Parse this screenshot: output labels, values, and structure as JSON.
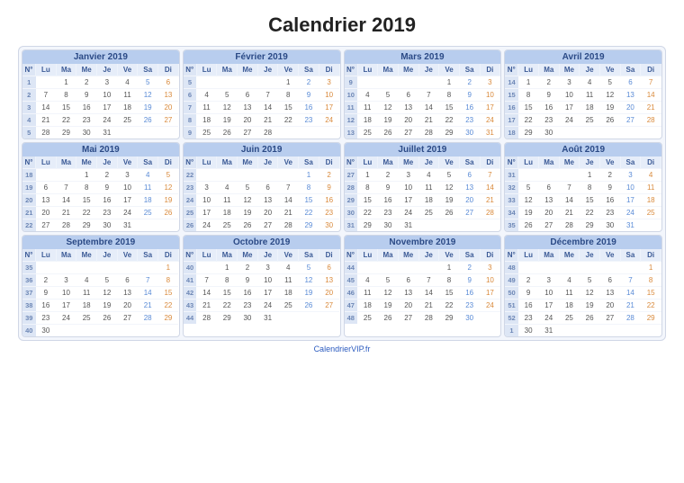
{
  "title": "Calendrier 2019",
  "footer": "CalendrierVIP.fr",
  "dayHeaders": [
    "N°",
    "Lu",
    "Ma",
    "Me",
    "Je",
    "Ve",
    "Sa",
    "Di"
  ],
  "months": [
    {
      "name": "Janvier 2019",
      "weeks": [
        {
          "wk": 1,
          "d": [
            "",
            "1",
            "2",
            "3",
            "4",
            "5",
            "6"
          ]
        },
        {
          "wk": 2,
          "d": [
            "7",
            "8",
            "9",
            "10",
            "11",
            "12",
            "13"
          ]
        },
        {
          "wk": 3,
          "d": [
            "14",
            "15",
            "16",
            "17",
            "18",
            "19",
            "20"
          ]
        },
        {
          "wk": 4,
          "d": [
            "21",
            "22",
            "23",
            "24",
            "25",
            "26",
            "27"
          ]
        },
        {
          "wk": 5,
          "d": [
            "28",
            "29",
            "30",
            "31",
            "",
            "",
            ""
          ]
        }
      ]
    },
    {
      "name": "Février 2019",
      "weeks": [
        {
          "wk": 5,
          "d": [
            "",
            "",
            "",
            "",
            "1",
            "2",
            "3"
          ]
        },
        {
          "wk": 6,
          "d": [
            "4",
            "5",
            "6",
            "7",
            "8",
            "9",
            "10"
          ]
        },
        {
          "wk": 7,
          "d": [
            "11",
            "12",
            "13",
            "14",
            "15",
            "16",
            "17"
          ]
        },
        {
          "wk": 8,
          "d": [
            "18",
            "19",
            "20",
            "21",
            "22",
            "23",
            "24"
          ]
        },
        {
          "wk": 9,
          "d": [
            "25",
            "26",
            "27",
            "28",
            "",
            "",
            ""
          ]
        }
      ]
    },
    {
      "name": "Mars 2019",
      "weeks": [
        {
          "wk": 9,
          "d": [
            "",
            "",
            "",
            "",
            "1",
            "2",
            "3"
          ]
        },
        {
          "wk": 10,
          "d": [
            "4",
            "5",
            "6",
            "7",
            "8",
            "9",
            "10"
          ]
        },
        {
          "wk": 11,
          "d": [
            "11",
            "12",
            "13",
            "14",
            "15",
            "16",
            "17"
          ]
        },
        {
          "wk": 12,
          "d": [
            "18",
            "19",
            "20",
            "21",
            "22",
            "23",
            "24"
          ]
        },
        {
          "wk": 13,
          "d": [
            "25",
            "26",
            "27",
            "28",
            "29",
            "30",
            "31"
          ]
        }
      ]
    },
    {
      "name": "Avril 2019",
      "weeks": [
        {
          "wk": 14,
          "d": [
            "1",
            "2",
            "3",
            "4",
            "5",
            "6",
            "7"
          ]
        },
        {
          "wk": 15,
          "d": [
            "8",
            "9",
            "10",
            "11",
            "12",
            "13",
            "14"
          ]
        },
        {
          "wk": 16,
          "d": [
            "15",
            "16",
            "17",
            "18",
            "19",
            "20",
            "21"
          ]
        },
        {
          "wk": 17,
          "d": [
            "22",
            "23",
            "24",
            "25",
            "26",
            "27",
            "28"
          ]
        },
        {
          "wk": 18,
          "d": [
            "29",
            "30",
            "",
            "",
            "",
            "",
            ""
          ]
        }
      ]
    },
    {
      "name": "Mai 2019",
      "weeks": [
        {
          "wk": 18,
          "d": [
            "",
            "",
            "1",
            "2",
            "3",
            "4",
            "5"
          ]
        },
        {
          "wk": 19,
          "d": [
            "6",
            "7",
            "8",
            "9",
            "10",
            "11",
            "12"
          ]
        },
        {
          "wk": 20,
          "d": [
            "13",
            "14",
            "15",
            "16",
            "17",
            "18",
            "19"
          ]
        },
        {
          "wk": 21,
          "d": [
            "20",
            "21",
            "22",
            "23",
            "24",
            "25",
            "26"
          ]
        },
        {
          "wk": 22,
          "d": [
            "27",
            "28",
            "29",
            "30",
            "31",
            "",
            ""
          ]
        }
      ]
    },
    {
      "name": "Juin 2019",
      "weeks": [
        {
          "wk": 22,
          "d": [
            "",
            "",
            "",
            "",
            "",
            "1",
            "2"
          ]
        },
        {
          "wk": 23,
          "d": [
            "3",
            "4",
            "5",
            "6",
            "7",
            "8",
            "9"
          ]
        },
        {
          "wk": 24,
          "d": [
            "10",
            "11",
            "12",
            "13",
            "14",
            "15",
            "16"
          ]
        },
        {
          "wk": 25,
          "d": [
            "17",
            "18",
            "19",
            "20",
            "21",
            "22",
            "23"
          ]
        },
        {
          "wk": 26,
          "d": [
            "24",
            "25",
            "26",
            "27",
            "28",
            "29",
            "30"
          ]
        }
      ]
    },
    {
      "name": "Juillet 2019",
      "weeks": [
        {
          "wk": 27,
          "d": [
            "1",
            "2",
            "3",
            "4",
            "5",
            "6",
            "7"
          ]
        },
        {
          "wk": 28,
          "d": [
            "8",
            "9",
            "10",
            "11",
            "12",
            "13",
            "14"
          ]
        },
        {
          "wk": 29,
          "d": [
            "15",
            "16",
            "17",
            "18",
            "19",
            "20",
            "21"
          ]
        },
        {
          "wk": 30,
          "d": [
            "22",
            "23",
            "24",
            "25",
            "26",
            "27",
            "28"
          ]
        },
        {
          "wk": 31,
          "d": [
            "29",
            "30",
            "31",
            "",
            "",
            "",
            ""
          ]
        }
      ]
    },
    {
      "name": "Août 2019",
      "weeks": [
        {
          "wk": 31,
          "d": [
            "",
            "",
            "",
            "1",
            "2",
            "3",
            "4"
          ]
        },
        {
          "wk": 32,
          "d": [
            "5",
            "6",
            "7",
            "8",
            "9",
            "10",
            "11"
          ]
        },
        {
          "wk": 33,
          "d": [
            "12",
            "13",
            "14",
            "15",
            "16",
            "17",
            "18"
          ]
        },
        {
          "wk": 34,
          "d": [
            "19",
            "20",
            "21",
            "22",
            "23",
            "24",
            "25"
          ]
        },
        {
          "wk": 35,
          "d": [
            "26",
            "27",
            "28",
            "29",
            "30",
            "31",
            ""
          ]
        }
      ]
    },
    {
      "name": "Septembre 2019",
      "weeks": [
        {
          "wk": 35,
          "d": [
            "",
            "",
            "",
            "",
            "",
            "",
            "1"
          ]
        },
        {
          "wk": 36,
          "d": [
            "2",
            "3",
            "4",
            "5",
            "6",
            "7",
            "8"
          ]
        },
        {
          "wk": 37,
          "d": [
            "9",
            "10",
            "11",
            "12",
            "13",
            "14",
            "15"
          ]
        },
        {
          "wk": 38,
          "d": [
            "16",
            "17",
            "18",
            "19",
            "20",
            "21",
            "22"
          ]
        },
        {
          "wk": 39,
          "d": [
            "23",
            "24",
            "25",
            "26",
            "27",
            "28",
            "29"
          ]
        },
        {
          "wk": 40,
          "d": [
            "30",
            "",
            "",
            "",
            "",
            "",
            ""
          ]
        }
      ]
    },
    {
      "name": "Octobre 2019",
      "weeks": [
        {
          "wk": 40,
          "d": [
            "",
            "1",
            "2",
            "3",
            "4",
            "5",
            "6"
          ]
        },
        {
          "wk": 41,
          "d": [
            "7",
            "8",
            "9",
            "10",
            "11",
            "12",
            "13"
          ]
        },
        {
          "wk": 42,
          "d": [
            "14",
            "15",
            "16",
            "17",
            "18",
            "19",
            "20"
          ]
        },
        {
          "wk": 43,
          "d": [
            "21",
            "22",
            "23",
            "24",
            "25",
            "26",
            "27"
          ]
        },
        {
          "wk": 44,
          "d": [
            "28",
            "29",
            "30",
            "31",
            "",
            "",
            ""
          ]
        }
      ]
    },
    {
      "name": "Novembre 2019",
      "weeks": [
        {
          "wk": 44,
          "d": [
            "",
            "",
            "",
            "",
            "1",
            "2",
            "3"
          ]
        },
        {
          "wk": 45,
          "d": [
            "4",
            "5",
            "6",
            "7",
            "8",
            "9",
            "10"
          ]
        },
        {
          "wk": 46,
          "d": [
            "11",
            "12",
            "13",
            "14",
            "15",
            "16",
            "17"
          ]
        },
        {
          "wk": 47,
          "d": [
            "18",
            "19",
            "20",
            "21",
            "22",
            "23",
            "24"
          ]
        },
        {
          "wk": 48,
          "d": [
            "25",
            "26",
            "27",
            "28",
            "29",
            "30",
            ""
          ]
        }
      ]
    },
    {
      "name": "Décembre 2019",
      "weeks": [
        {
          "wk": 48,
          "d": [
            "",
            "",
            "",
            "",
            "",
            "",
            "1"
          ]
        },
        {
          "wk": 49,
          "d": [
            "2",
            "3",
            "4",
            "5",
            "6",
            "7",
            "8"
          ]
        },
        {
          "wk": 50,
          "d": [
            "9",
            "10",
            "11",
            "12",
            "13",
            "14",
            "15"
          ]
        },
        {
          "wk": 51,
          "d": [
            "16",
            "17",
            "18",
            "19",
            "20",
            "21",
            "22"
          ]
        },
        {
          "wk": 52,
          "d": [
            "23",
            "24",
            "25",
            "26",
            "27",
            "28",
            "29"
          ]
        },
        {
          "wk": 1,
          "d": [
            "30",
            "31",
            "",
            "",
            "",
            "",
            ""
          ]
        }
      ]
    }
  ]
}
